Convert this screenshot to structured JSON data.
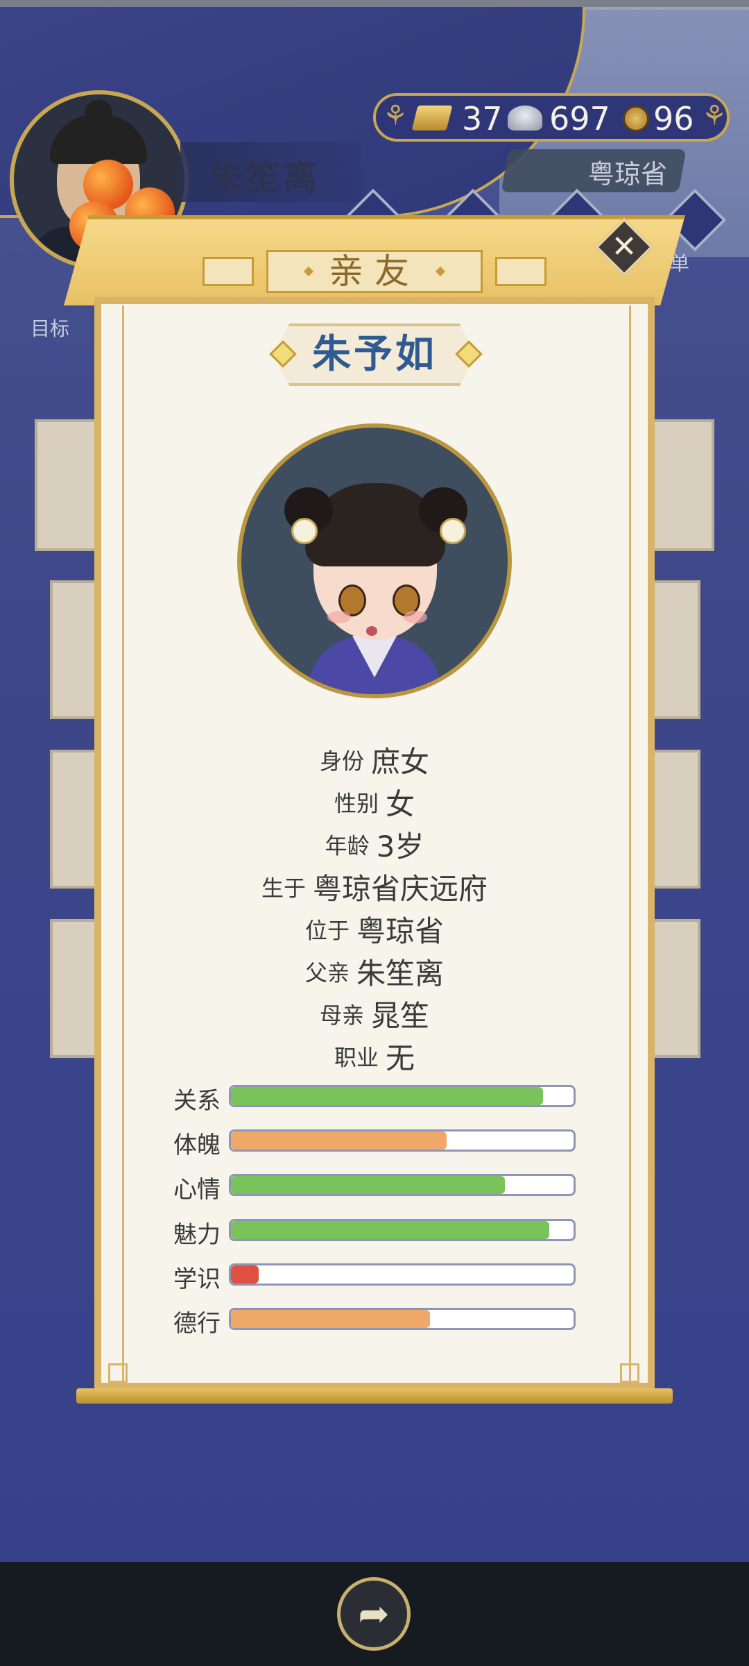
{
  "header_hud": {
    "player_name": "朱笙离",
    "currency": {
      "gold": "37",
      "silver": "697",
      "coins": "96",
      "gold_icon": "gold-ingot-icon",
      "silver_icon": "silver-ingot-icon",
      "coin_icon": "copper-coin-icon"
    },
    "location": "粤琼省",
    "menu_label": "菜单",
    "goal_label": "目标"
  },
  "modal": {
    "title": "亲友",
    "character_name": "朱予如",
    "info": [
      {
        "label": "身份",
        "value": "庶女"
      },
      {
        "label": "性别",
        "value": "女"
      },
      {
        "label": "年龄",
        "value": "3岁"
      },
      {
        "label": "生于",
        "value": "粤琼省庆远府"
      },
      {
        "label": "位于",
        "value": "粤琼省"
      },
      {
        "label": "父亲",
        "value": "朱笙离"
      },
      {
        "label": "母亲",
        "value": "晁笙"
      },
      {
        "label": "职业",
        "value": "无"
      }
    ],
    "stats": [
      {
        "label": "关系",
        "value": 0.91,
        "color": "#7ac35a"
      },
      {
        "label": "体魄",
        "value": 0.63,
        "color": "#f0a868"
      },
      {
        "label": "心情",
        "value": 0.8,
        "color": "#7ac35a"
      },
      {
        "label": "魅力",
        "value": 0.93,
        "color": "#7ac35a"
      },
      {
        "label": "学识",
        "value": 0.08,
        "color": "#e05040"
      },
      {
        "label": "德行",
        "value": 0.58,
        "color": "#f0a868"
      }
    ]
  },
  "footer": {
    "share_icon": "share-icon"
  }
}
